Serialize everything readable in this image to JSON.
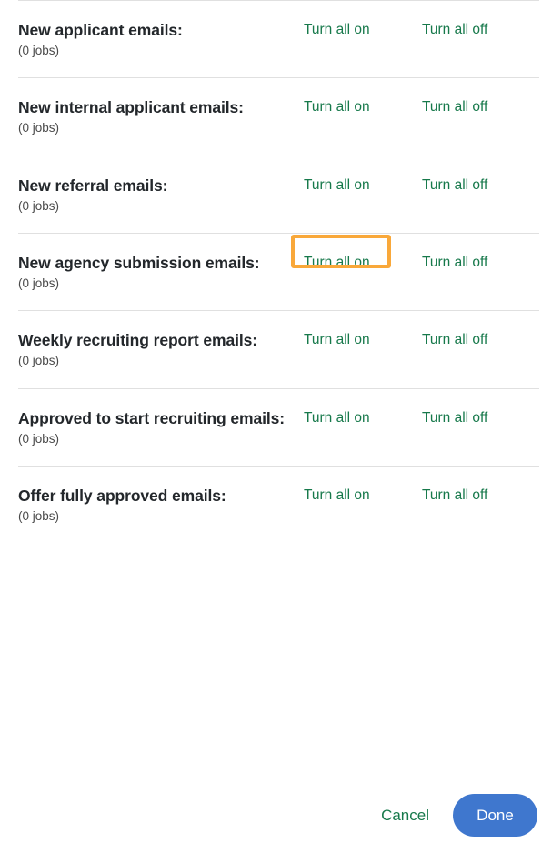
{
  "colors": {
    "link_green": "#17794b",
    "focus_orange": "#f9a83a",
    "primary_blue": "#3f77ce",
    "divider": "#e0e0e0",
    "title_text": "#23272b",
    "count_text": "#4a4a4a"
  },
  "rows": [
    {
      "title": "New applicant emails:",
      "count": "(0 jobs)",
      "turn_on": "Turn all on",
      "turn_off": "Turn all off",
      "focused": false
    },
    {
      "title": "New internal applicant emails:",
      "count": "(0 jobs)",
      "turn_on": "Turn all on",
      "turn_off": "Turn all off",
      "focused": false
    },
    {
      "title": "New referral emails:",
      "count": "(0 jobs)",
      "turn_on": "Turn all on",
      "turn_off": "Turn all off",
      "focused": false
    },
    {
      "title": "New agency submission emails:",
      "count": "(0 jobs)",
      "turn_on": "Turn all on",
      "turn_off": "Turn all off",
      "focused": true
    },
    {
      "title": "Weekly recruiting report emails:",
      "count": "(0 jobs)",
      "turn_on": "Turn all on",
      "turn_off": "Turn all off",
      "focused": false
    },
    {
      "title": "Approved to start recruiting emails:",
      "count": "(0 jobs)",
      "turn_on": "Turn all on",
      "turn_off": "Turn all off",
      "focused": false
    },
    {
      "title": "Offer fully approved emails:",
      "count": "(0 jobs)",
      "turn_on": "Turn all on",
      "turn_off": "Turn all off",
      "focused": false
    }
  ],
  "footer": {
    "cancel_label": "Cancel",
    "done_label": "Done"
  }
}
